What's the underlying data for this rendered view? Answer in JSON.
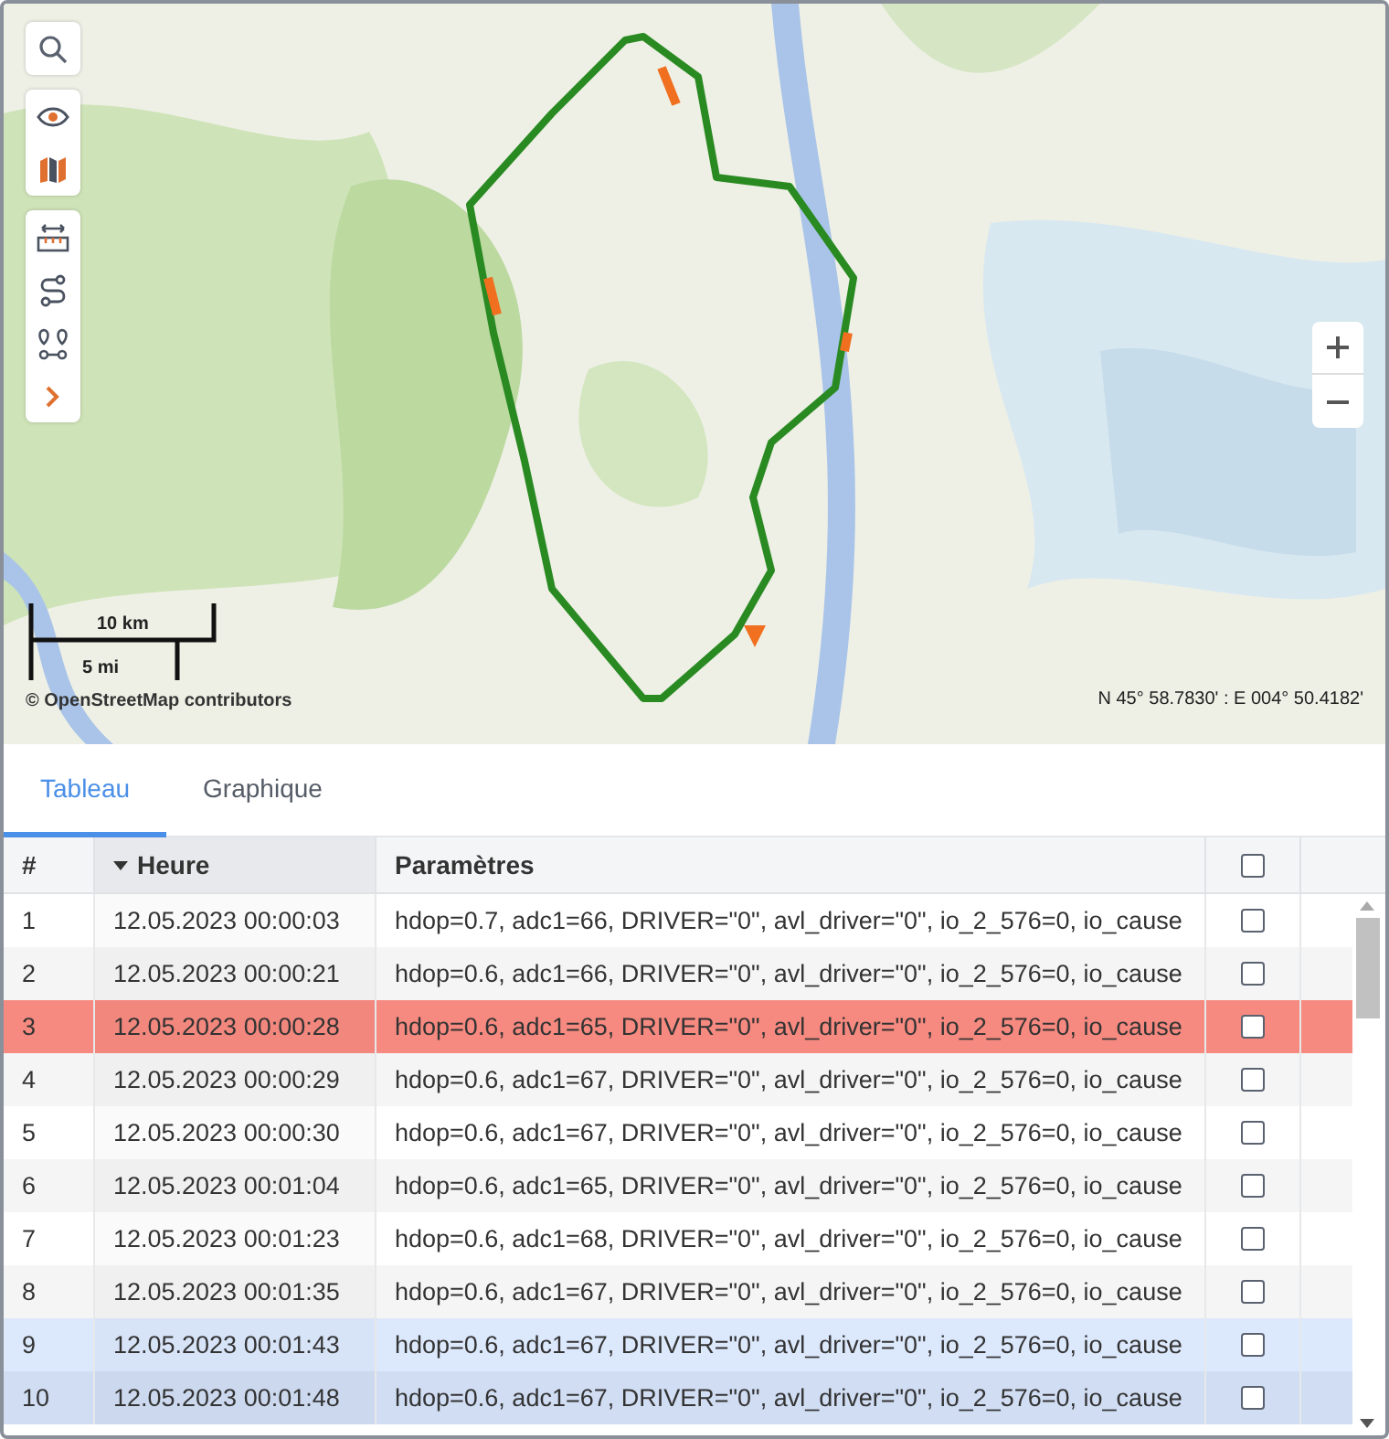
{
  "map": {
    "scale_metric": "10 km",
    "scale_imperial": "5 mi",
    "attribution": "© OpenStreetMap contributors",
    "coordinates": "N 45° 58.7830' : E 004° 50.4182'"
  },
  "tabs": [
    {
      "label": "Tableau",
      "selected": true
    },
    {
      "label": "Graphique",
      "selected": false
    }
  ],
  "table": {
    "columns": [
      {
        "label": "#",
        "sorted": false
      },
      {
        "label": "Heure",
        "sorted": true
      },
      {
        "label": "Paramètres",
        "sorted": false
      }
    ],
    "all_checked": false,
    "rows": [
      {
        "index": "1",
        "time": "12.05.2023 00:00:03",
        "params": "hdop=0.7, adc1=66, DRIVER=\"0\", avl_driver=\"0\", io_2_576=0, io_cause",
        "checked": false,
        "alert": false,
        "selected": false
      },
      {
        "index": "2",
        "time": "12.05.2023 00:00:21",
        "params": "hdop=0.6, adc1=66, DRIVER=\"0\", avl_driver=\"0\", io_2_576=0, io_cause",
        "checked": false,
        "alert": false,
        "selected": false
      },
      {
        "index": "3",
        "time": "12.05.2023 00:00:28",
        "params": "hdop=0.6, adc1=65, DRIVER=\"0\", avl_driver=\"0\", io_2_576=0, io_cause",
        "checked": false,
        "alert": true,
        "selected": false
      },
      {
        "index": "4",
        "time": "12.05.2023 00:00:29",
        "params": "hdop=0.6, adc1=67, DRIVER=\"0\", avl_driver=\"0\", io_2_576=0, io_cause",
        "checked": false,
        "alert": false,
        "selected": false
      },
      {
        "index": "5",
        "time": "12.05.2023 00:00:30",
        "params": "hdop=0.6, adc1=67, DRIVER=\"0\", avl_driver=\"0\", io_2_576=0, io_cause",
        "checked": false,
        "alert": false,
        "selected": false
      },
      {
        "index": "6",
        "time": "12.05.2023 00:01:04",
        "params": "hdop=0.6, adc1=65, DRIVER=\"0\", avl_driver=\"0\", io_2_576=0, io_cause",
        "checked": false,
        "alert": false,
        "selected": false
      },
      {
        "index": "7",
        "time": "12.05.2023 00:01:23",
        "params": "hdop=0.6, adc1=68, DRIVER=\"0\", avl_driver=\"0\", io_2_576=0, io_cause",
        "checked": false,
        "alert": false,
        "selected": false
      },
      {
        "index": "8",
        "time": "12.05.2023 00:01:35",
        "params": "hdop=0.6, adc1=67, DRIVER=\"0\", avl_driver=\"0\", io_2_576=0, io_cause",
        "checked": false,
        "alert": false,
        "selected": false
      },
      {
        "index": "9",
        "time": "12.05.2023 00:01:43",
        "params": "hdop=0.6, adc1=67, DRIVER=\"0\", avl_driver=\"0\", io_2_576=0, io_cause",
        "checked": false,
        "alert": false,
        "selected": true
      },
      {
        "index": "10",
        "time": "12.05.2023 00:01:48",
        "params": "hdop=0.6, adc1=67, DRIVER=\"0\", avl_driver=\"0\", io_2_576=0, io_cause",
        "checked": false,
        "alert": false,
        "selected": true
      }
    ]
  }
}
